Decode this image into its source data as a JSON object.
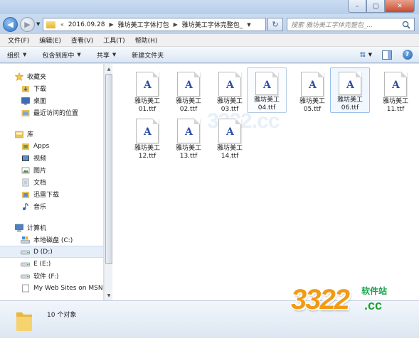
{
  "window": {
    "minimize_glyph": "–",
    "maximize_glyph": "▢",
    "close_glyph": "✕"
  },
  "navigation": {
    "back_glyph": "◀",
    "forward_glyph": "▶",
    "breadcrumb_prefix": "«",
    "breadcrumbs": [
      "2016.09.28",
      "雅坊美工字体打包",
      "雅坊美工字体完整包_"
    ],
    "search_placeholder": "搜索 雅坊美工字体完整包_...",
    "refresh_glyph": "↻"
  },
  "menu": {
    "items": [
      "文件(F)",
      "编辑(E)",
      "查看(V)",
      "工具(T)",
      "帮助(H)"
    ]
  },
  "commands": {
    "organize": "组织",
    "include_in_library": "包含到库中",
    "share": "共享",
    "new_folder": "新建文件夹",
    "help_glyph": "?"
  },
  "sidebar": {
    "favorites": {
      "label": "收藏夹",
      "items": [
        "下载",
        "桌面",
        "最近访问的位置"
      ]
    },
    "libraries": {
      "label": "库",
      "items": [
        "Apps",
        "视频",
        "图片",
        "文档",
        "迅雷下载",
        "音乐"
      ]
    },
    "computer": {
      "label": "计算机",
      "items": [
        "本地磁盘 (C:)",
        "D (D:)",
        "E (E:)",
        "软件 (F:)",
        "My Web Sites on MSN"
      ]
    }
  },
  "files": [
    {
      "line1": "雅坊美工",
      "line2": "01.ttf",
      "state": "normal"
    },
    {
      "line1": "雅坊美工",
      "line2": "02.ttf",
      "state": "normal"
    },
    {
      "line1": "雅坊美工",
      "line2": "03.ttf",
      "state": "normal"
    },
    {
      "line1": "雅坊美工",
      "line2": "04.ttf",
      "state": "hover"
    },
    {
      "line1": "雅坊美工",
      "line2": "05.ttf",
      "state": "normal"
    },
    {
      "line1": "雅坊美工",
      "line2": "06.ttf",
      "state": "selected"
    },
    {
      "line1": "雅坊美工",
      "line2": "11.ttf",
      "state": "normal"
    },
    {
      "line1": "雅坊美工",
      "line2": "12.ttf",
      "state": "normal"
    },
    {
      "line1": "雅坊美工",
      "line2": "13.ttf",
      "state": "normal"
    },
    {
      "line1": "雅坊美工",
      "line2": "14.ttf",
      "state": "normal"
    }
  ],
  "file_icon_glyph": "A",
  "content_watermark": "3322.cc",
  "status": {
    "item_count": "10 个对象"
  },
  "logo": {
    "number": "3322",
    "site_label": "软件站",
    "domain": ".cc"
  },
  "colors": {
    "accent": "#2a70c6",
    "selection": "#9bc0e8",
    "logo_orange": "#f39a14",
    "logo_green": "#1aa02e"
  }
}
